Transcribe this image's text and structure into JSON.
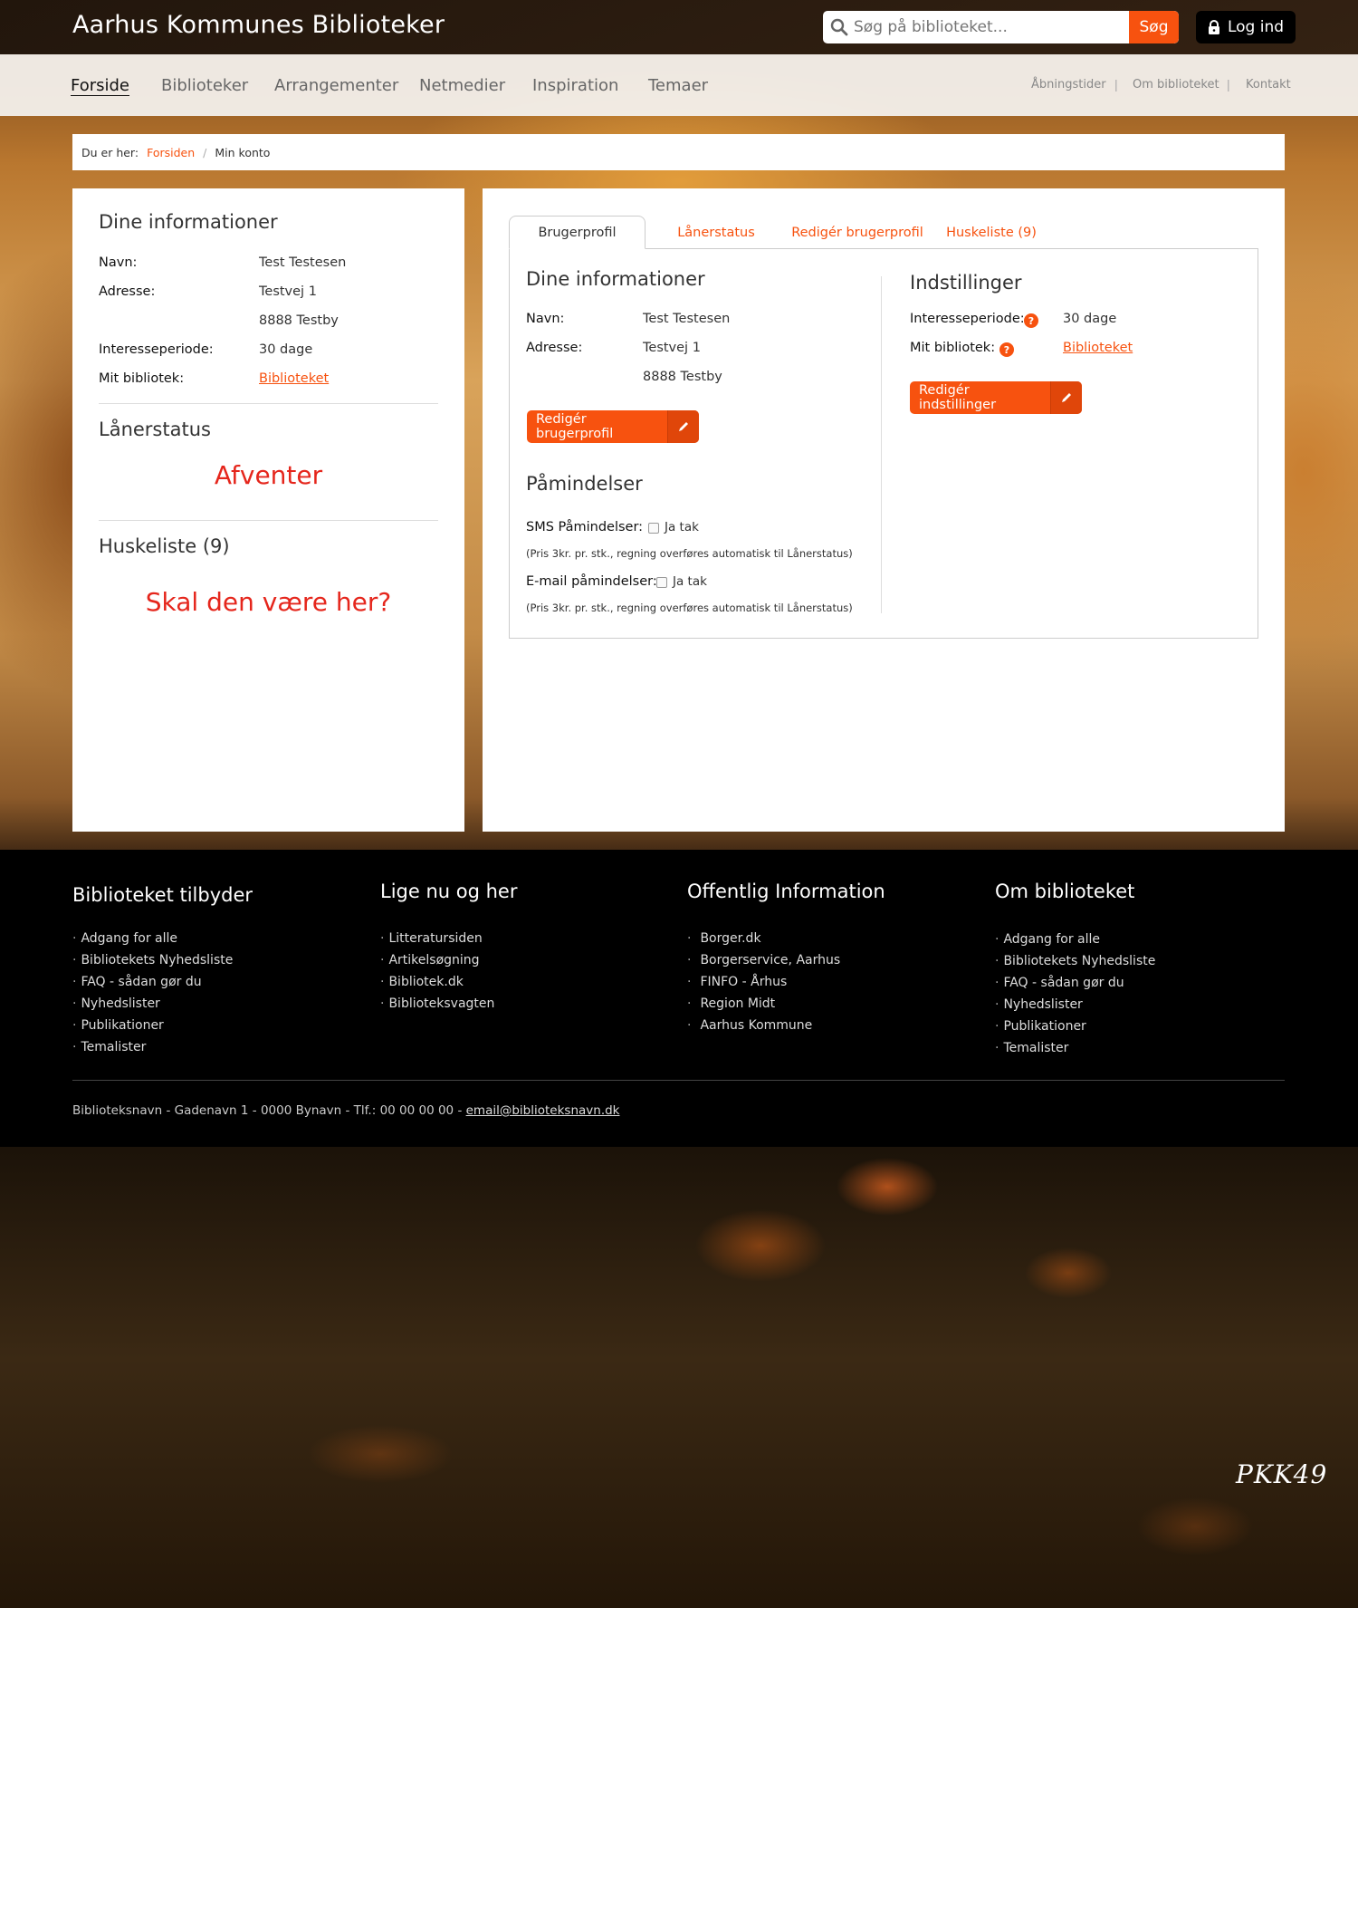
{
  "header": {
    "site_title": "Aarhus Kommunes Biblioteker",
    "search_placeholder": "Søg på biblioteket...",
    "search_button": "Søg",
    "login_label": "Log ind"
  },
  "nav": {
    "items": [
      {
        "label": "Forside",
        "active": true
      },
      {
        "label": "Biblioteker"
      },
      {
        "label": "Arrangementer"
      },
      {
        "label": "Netmedier"
      },
      {
        "label": "Inspiration"
      },
      {
        "label": "Temaer"
      }
    ],
    "utility_links": [
      "Åbningstider",
      "Om biblioteket",
      "Kontakt"
    ]
  },
  "breadcrumb": {
    "label": "Du er her:",
    "home": "Forsiden",
    "separator": "/",
    "current": "Min konto"
  },
  "left_panel": {
    "info_heading": "Dine informationer",
    "name_label": "Navn:",
    "name_value": "Test Testesen",
    "address_label": "Adresse:",
    "address_line1": "Testvej 1",
    "address_line2": "8888 Testby",
    "interest_label": "Interesseperiode:",
    "interest_value": "30 dage",
    "library_label": "Mit bibliotek:",
    "library_value": "Biblioteket",
    "loan_status_heading": "Lånerstatus",
    "loan_status_value": "Afventer",
    "wishlist_heading": "Huskeliste (9)",
    "wishlist_message": "Skal den være her?"
  },
  "tabs": [
    {
      "label": "Brugerprofil",
      "active": true
    },
    {
      "label": "Lånerstatus"
    },
    {
      "label": "Redigér brugerprofil"
    },
    {
      "label": "Huskeliste (9)"
    }
  ],
  "profile": {
    "info_heading": "Dine informationer",
    "name_label": "Navn:",
    "name_value": "Test Testesen",
    "address_label": "Adresse:",
    "address_line1": "Testvej 1",
    "address_line2": "8888 Testby",
    "edit_profile_button": "Redigér brugerprofil",
    "reminders_heading": "Påmindelser",
    "sms_label": "SMS Påmindelser:",
    "sms_option": "Ja tak",
    "sms_note": "(Pris 3kr. pr. stk., regning overføres automatisk til Lånerstatus)",
    "email_label": "E-mail påmindelser:",
    "email_option": "Ja tak",
    "email_note": "(Pris 3kr. pr. stk., regning overføres automatisk til Lånerstatus)"
  },
  "settings": {
    "heading": "Indstillinger",
    "interest_label": "Interesseperiode:",
    "interest_value": "30 dage",
    "library_label": "Mit bibliotek:",
    "library_value": "Biblioteket",
    "edit_settings_button": "Redigér indstillinger",
    "help_icon_glyph": "?"
  },
  "footer": {
    "columns": [
      {
        "heading": "Biblioteket tilbyder",
        "items": [
          "Adgang for alle",
          "Bibliotekets Nyhedsliste",
          "FAQ - sådan gør du",
          "Nyhedslister",
          "Publikationer",
          "Temalister"
        ]
      },
      {
        "heading": "Lige nu og her",
        "items": [
          "Litteratursiden",
          "Artikelsøgning",
          "Bibliotek.dk",
          "Biblioteksvagten"
        ]
      },
      {
        "heading": "Offentlig Information",
        "items": [
          "Borger.dk",
          "Borgerservice, Aarhus",
          "FINFO - Århus",
          "Region Midt",
          "Aarhus Kommune"
        ]
      },
      {
        "heading": "Om biblioteket",
        "items": [
          "Adgang for alle",
          "Bibliotekets Nyhedsliste",
          "FAQ - sådan gør du",
          "Nyhedslister",
          "Publikationer",
          "Temalister"
        ]
      }
    ],
    "address_text": "Biblioteksnavn - Gadenavn 1 - 0000 Bynavn - Tlf.: 00 00 00 00 - ",
    "email": "email@biblioteksnavn.dk",
    "bullet": "·"
  },
  "watermark": "PKK49",
  "colors": {
    "accent": "#f7520f",
    "status_red": "#e5261c",
    "topbar": "#1e140c",
    "footer": "#000000"
  },
  "icons": {
    "search": "search-icon",
    "lock": "lock-icon",
    "pencil": "pencil-icon",
    "help": "help-icon"
  }
}
